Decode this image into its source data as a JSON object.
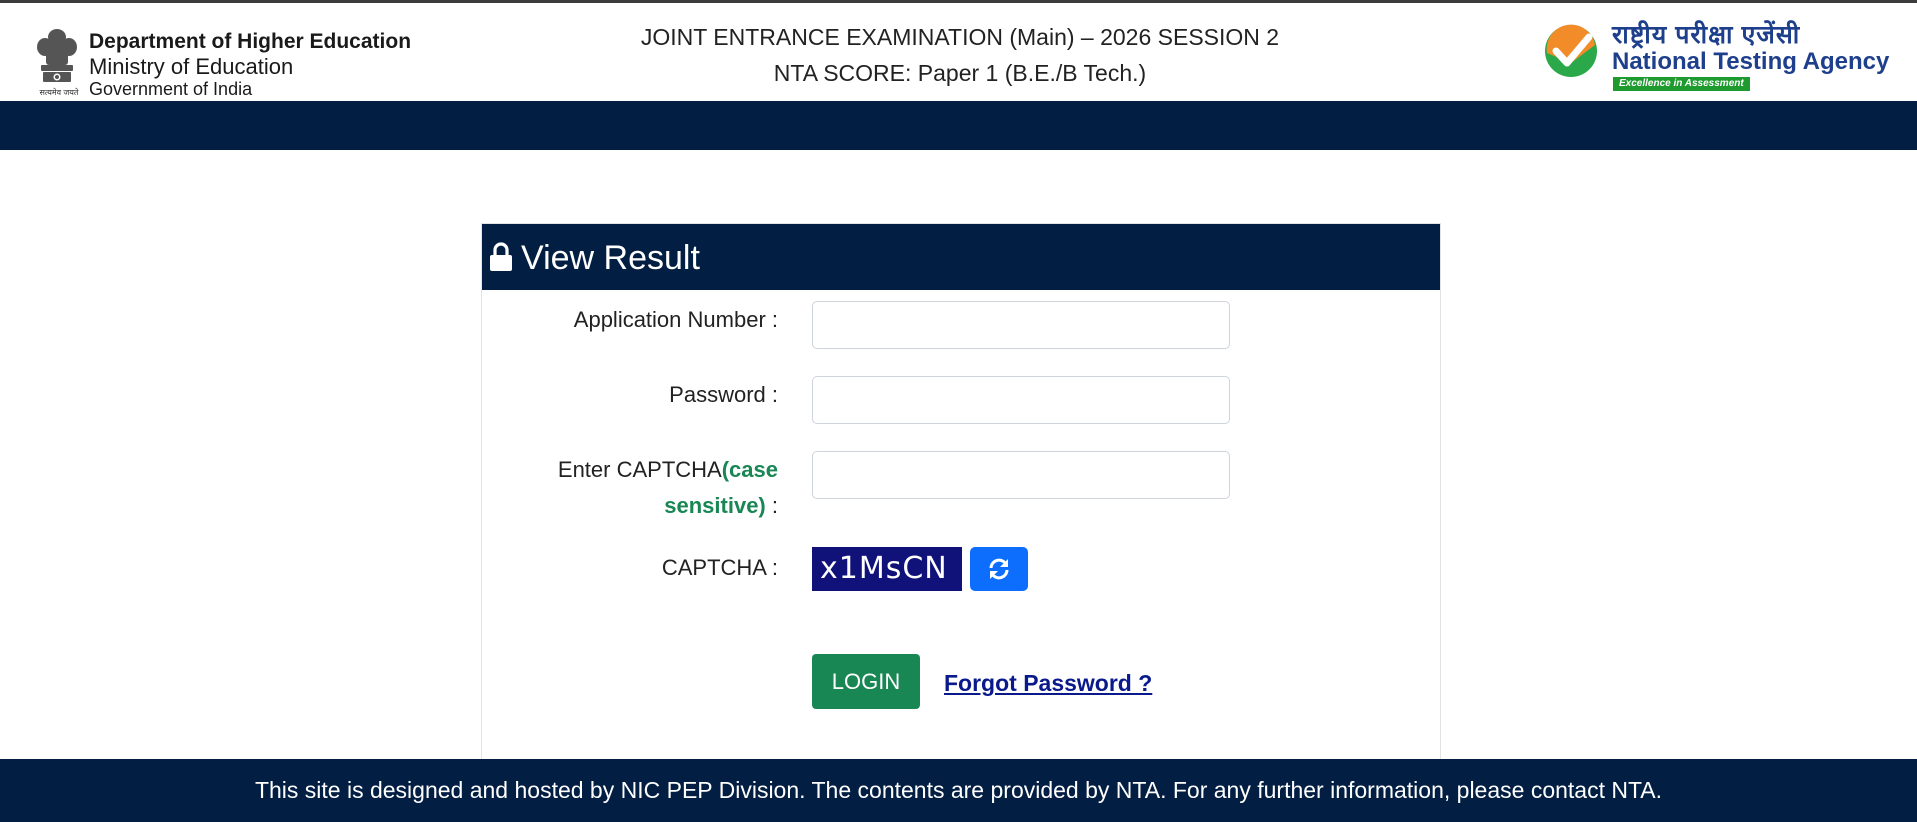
{
  "header": {
    "gov": {
      "dept": "Department of Higher Education",
      "ministry": "Ministry of Education",
      "government": "Government of India",
      "emblem_caption": "सत्यमेव जयते"
    },
    "exam_title_line1": "JOINT ENTRANCE EXAMINATION (Main) – 2026 SESSION 2",
    "exam_title_line2": "NTA SCORE: Paper 1 (B.E./B Tech.)",
    "nta": {
      "hindi_name": "राष्ट्रीय परीक्षा एजेंसी",
      "english_name": "National Testing Agency",
      "tagline": "Excellence in Assessment"
    }
  },
  "card": {
    "title": "View Result",
    "application_number_label": "Application Number :",
    "application_number_value": "",
    "password_label": "Password :",
    "password_value": "",
    "captcha_input_label_prefix": "Enter CAPTCHA",
    "captcha_input_label_green": "(case sensitive)",
    "captcha_input_label_suffix": " :",
    "captcha_input_value": "",
    "captcha_label": "CAPTCHA :",
    "captcha_text": "x1MsCN",
    "login_label": "LOGIN",
    "forgot_password_label": "Forgot Password ?"
  },
  "footer": {
    "text": "This site is designed and hosted by NIC PEP Division. The contents are provided by NTA. For any further information, please contact NTA."
  },
  "colors": {
    "navy": "#021e42",
    "login_green": "#198754",
    "refresh_blue": "#0d6efd",
    "captcha_bg": "#10127a",
    "link_blue": "#0a1a8c"
  },
  "icons": {
    "card_title": "lock-icon",
    "refresh": "refresh-icon",
    "gov_logo": "state-emblem-icon",
    "nta_logo": "nta-checkmark-logo-icon"
  }
}
